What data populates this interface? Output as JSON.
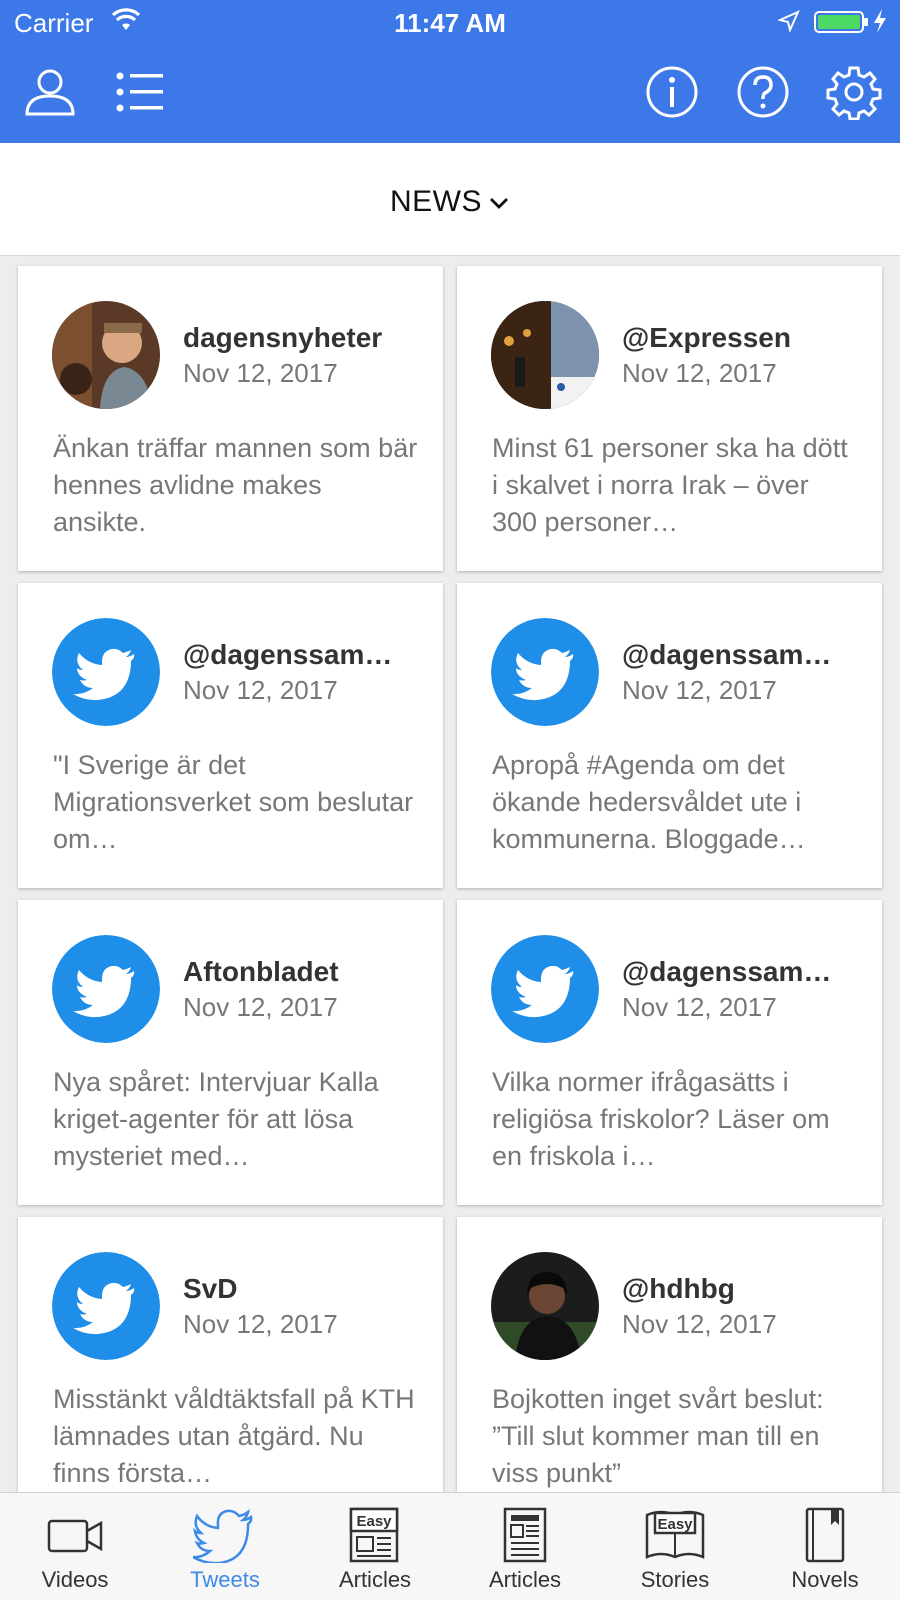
{
  "status_bar": {
    "carrier": "Carrier",
    "time": "11:47 AM"
  },
  "toolbar": {
    "icons": [
      "profile-icon",
      "list-icon",
      "info-icon",
      "help-icon",
      "settings-icon"
    ],
    "color": "#3d78e8"
  },
  "category": {
    "label": "NEWS"
  },
  "cards": [
    {
      "author": "dagensnyheter",
      "date": "Nov 12, 2017",
      "text": "Änkan träffar mannen som bär hennes avlidne makes ansikte.",
      "avatar": "photo"
    },
    {
      "author": "@Expressen",
      "date": "Nov 12, 2017",
      "text": "Minst 61 personer ska ha dött i skalvet i norra Irak – över 300 personer…",
      "avatar": "photo"
    },
    {
      "author": "@dagenssam…",
      "date": "Nov 12, 2017",
      "text": "\"I Sverige är det Migrationsverket som beslutar om…",
      "avatar": "twitter"
    },
    {
      "author": "@dagenssam…",
      "date": "Nov 12, 2017",
      "text": "Apropå #Agenda om det ökande hedersvåldet ute i kommunerna. Bloggade…",
      "avatar": "twitter"
    },
    {
      "author": "Aftonbladet",
      "date": "Nov 12, 2017",
      "text": "Nya spåret: Intervjuar Kalla kriget-agenter för att lösa mysteriet med…",
      "avatar": "twitter"
    },
    {
      "author": "@dagenssam…",
      "date": "Nov 12, 2017",
      "text": "Vilka normer ifrågasätts i religiösa friskolor? Läser om en friskola i…",
      "avatar": "twitter"
    },
    {
      "author": "SvD",
      "date": "Nov 12, 2017",
      "text": "Misstänkt våldtäktsfall på KTH lämnades utan åtgärd. Nu finns första…",
      "avatar": "twitter"
    },
    {
      "author": "@hdhbg",
      "date": "Nov 12, 2017",
      "text": "Bojkotten inget svårt beslut: ”Till slut kommer man till en viss punkt”",
      "avatar": "photo"
    }
  ],
  "tabs": [
    {
      "label": "Videos",
      "icon": "video-icon",
      "active": false
    },
    {
      "label": "Tweets",
      "icon": "twitter-bird-icon",
      "active": true
    },
    {
      "label": "Articles",
      "icon": "easy-articles-icon",
      "active": false
    },
    {
      "label": "Articles",
      "icon": "articles-icon",
      "active": false
    },
    {
      "label": "Stories",
      "icon": "easy-stories-icon",
      "active": false
    },
    {
      "label": "Novels",
      "icon": "novels-icon",
      "active": false
    }
  ],
  "easy_badge": "Easy",
  "colors": {
    "twitter_blue": "#1e8ee8",
    "accent": "#3d8ae8"
  }
}
